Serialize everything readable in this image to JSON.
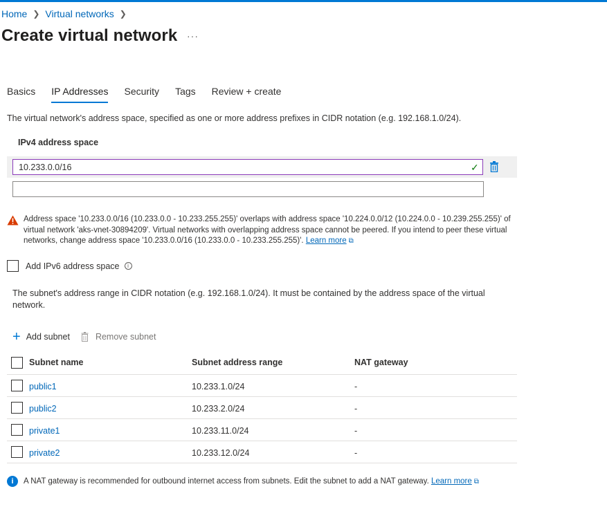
{
  "breadcrumb": {
    "items": [
      "Home",
      "Virtual networks"
    ]
  },
  "page": {
    "title": "Create virtual network",
    "more_label": "···"
  },
  "tabs": [
    {
      "label": "Basics"
    },
    {
      "label": "IP Addresses"
    },
    {
      "label": "Security"
    },
    {
      "label": "Tags"
    },
    {
      "label": "Review + create"
    }
  ],
  "address_space": {
    "description": "The virtual network's address space, specified as one or more address prefixes in CIDR notation (e.g. 192.168.1.0/24).",
    "ipv4_label": "IPv4 address space",
    "value": "10.233.0.0/16",
    "empty_value": ""
  },
  "warning": {
    "text": "Address space '10.233.0.0/16 (10.233.0.0 - 10.233.255.255)' overlaps with address space '10.224.0.0/12 (10.224.0.0 - 10.239.255.255)' of virtual network 'aks-vnet-30894209'. Virtual networks with overlapping address space cannot be peered. If you intend to peer these virtual networks, change address space '10.233.0.0/16 (10.233.0.0 - 10.233.255.255)'.",
    "link": "Learn more"
  },
  "ipv6": {
    "label": "Add IPv6 address space"
  },
  "subnets": {
    "description": "The subnet's address range in CIDR notation (e.g. 192.168.1.0/24). It must be contained by the address space of the virtual network.",
    "add_label": "Add subnet",
    "remove_label": "Remove subnet",
    "columns": [
      "Subnet name",
      "Subnet address range",
      "NAT gateway"
    ],
    "rows": [
      {
        "name": "public1",
        "range": "10.233.1.0/24",
        "nat": "-"
      },
      {
        "name": "public2",
        "range": "10.233.2.0/24",
        "nat": "-"
      },
      {
        "name": "private1",
        "range": "10.233.11.0/24",
        "nat": "-"
      },
      {
        "name": "private2",
        "range": "10.233.12.0/24",
        "nat": "-"
      }
    ]
  },
  "nat_note": {
    "text": "A NAT gateway is recommended for outbound internet access from subnets. Edit the subnet to add a NAT gateway.",
    "link": "Learn more"
  },
  "colors": {
    "accent": "#0078d4",
    "link": "#0067b8",
    "warning": "#d83b01",
    "valid": "#107c10"
  },
  "icons": [
    "chevron-right-icon",
    "check-icon",
    "trash-icon",
    "warning-icon",
    "external-link-icon",
    "info-icon",
    "plus-icon"
  ]
}
